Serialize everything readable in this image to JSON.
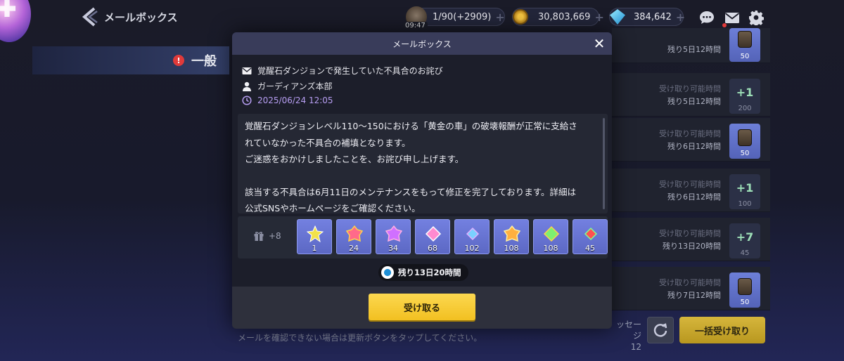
{
  "header": {
    "title": "メールボックス",
    "stamina": {
      "value": "1/90(+2909)",
      "timer": "09:47"
    },
    "gold": {
      "value": "30,803,669"
    },
    "gems": {
      "value": "384,642"
    }
  },
  "sidebar": {
    "category_label": "一般"
  },
  "mail_list": [
    {
      "status_line1": "",
      "status_line2": "残り5日12時間",
      "reward_type": "item",
      "reward_qty": "50",
      "blue": true
    },
    {
      "status_line1": "受け取り可能時間",
      "status_line2": "残り5日12時間",
      "reward_type": "plus",
      "reward_text": "+1",
      "reward_qty": "200",
      "blue": false
    },
    {
      "status_line1": "受け取り可能時間",
      "status_line2": "残り6日12時間",
      "reward_type": "item",
      "reward_qty": "50",
      "blue": true
    },
    {
      "status_line1": "受け取り可能時間",
      "status_line2": "残り6日12時間",
      "reward_type": "plus",
      "reward_text": "+1",
      "reward_qty": "100",
      "blue": false
    },
    {
      "status_line1": "受け取り可能時間",
      "status_line2": "残り13日20時間",
      "reward_type": "plus",
      "reward_text": "+7",
      "reward_qty": "45",
      "blue": false
    },
    {
      "status_line1": "受け取り可能時間",
      "status_line2": "残り7日12時間",
      "reward_type": "item",
      "reward_qty": "50",
      "blue": true
    }
  ],
  "footer": {
    "info_text": "メールを確認できない場合は更新ボタンをタップしてください。",
    "message_count_label": "ッセージ",
    "message_count": "12",
    "claim_all_label": "一括受け取り"
  },
  "modal": {
    "title": "メールボックス",
    "subject": "覚醒石ダンジョンで発生していた不具合のお詫び",
    "sender": "ガーディアンズ本部",
    "date": "2025/06/24 12:05",
    "body_lines": [
      "覚醒石ダンジョンレベル110～150における「黄金の車」の破壊報酬が正常に支給さ",
      "れていなかった不具合の補填となります。",
      "ご迷惑をおかけしましたことを、お詫び申し上げます。",
      "",
      "該当する不具合は6月11日のメンテナンスをもって修正を完了しております。詳細は",
      "公式SNSやホームページをご確認ください。"
    ],
    "gift_extra_count": "+8",
    "items": [
      {
        "qty": "1",
        "color": "#f2e24a"
      },
      {
        "qty": "24",
        "color": "#ff6a8a"
      },
      {
        "qty": "34",
        "color": "#d070ff"
      },
      {
        "qty": "68",
        "color": "#ff8ad0"
      },
      {
        "qty": "102",
        "color": "#7ad0ff"
      },
      {
        "qty": "108",
        "color": "#ffb040"
      },
      {
        "qty": "108",
        "color": "#7ef070"
      },
      {
        "qty": "45",
        "color": "#ff5050"
      }
    ],
    "expire_text": "残り13日20時間",
    "claim_label": "受け取る"
  },
  "colors": {
    "accent_yellow": "#f5c52a",
    "date_purple": "#b79ef2",
    "item_slot_blue": "#6874d6",
    "header_bar": "#393c5a"
  }
}
